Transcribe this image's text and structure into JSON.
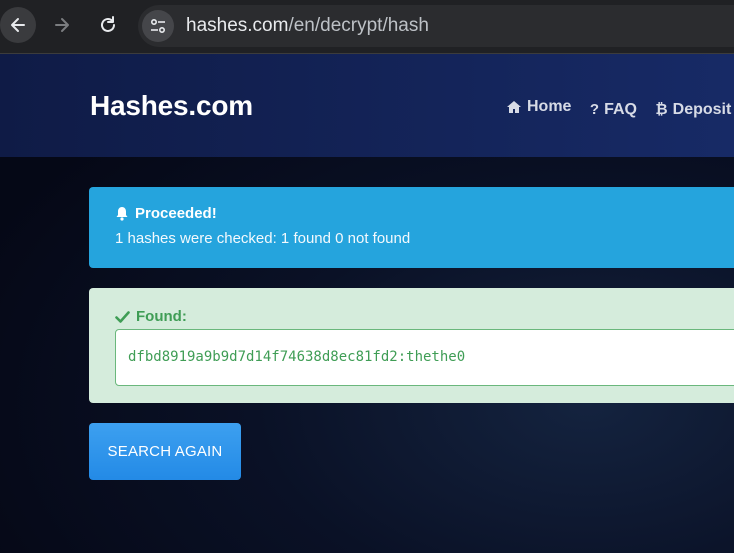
{
  "browser": {
    "url_host": "hashes.com",
    "url_path": "/en/decrypt/hash"
  },
  "header": {
    "brand": "Hashes.com",
    "nav": [
      {
        "label": "Home",
        "icon": "home-icon"
      },
      {
        "label": "FAQ",
        "icon": "question-icon"
      },
      {
        "label": "Deposit",
        "icon": "bitcoin-icon"
      }
    ]
  },
  "alert": {
    "title": "Proceeded!",
    "icon": "bell-icon",
    "message": "1 hashes were checked: 1 found 0 not found"
  },
  "result": {
    "label": "Found:",
    "icon": "check-icon",
    "value": "dfbd8919a9b9d7d14f74638d8ec81fd2:thethe0"
  },
  "actions": {
    "search_again_label": "SEARCH AGAIN"
  },
  "colors": {
    "alert_bg": "#25a4dd",
    "found_bg": "#d5ecdc",
    "found_text": "#3f9d55",
    "button_bg": "#238ae6",
    "header_bg": "#172a66"
  }
}
